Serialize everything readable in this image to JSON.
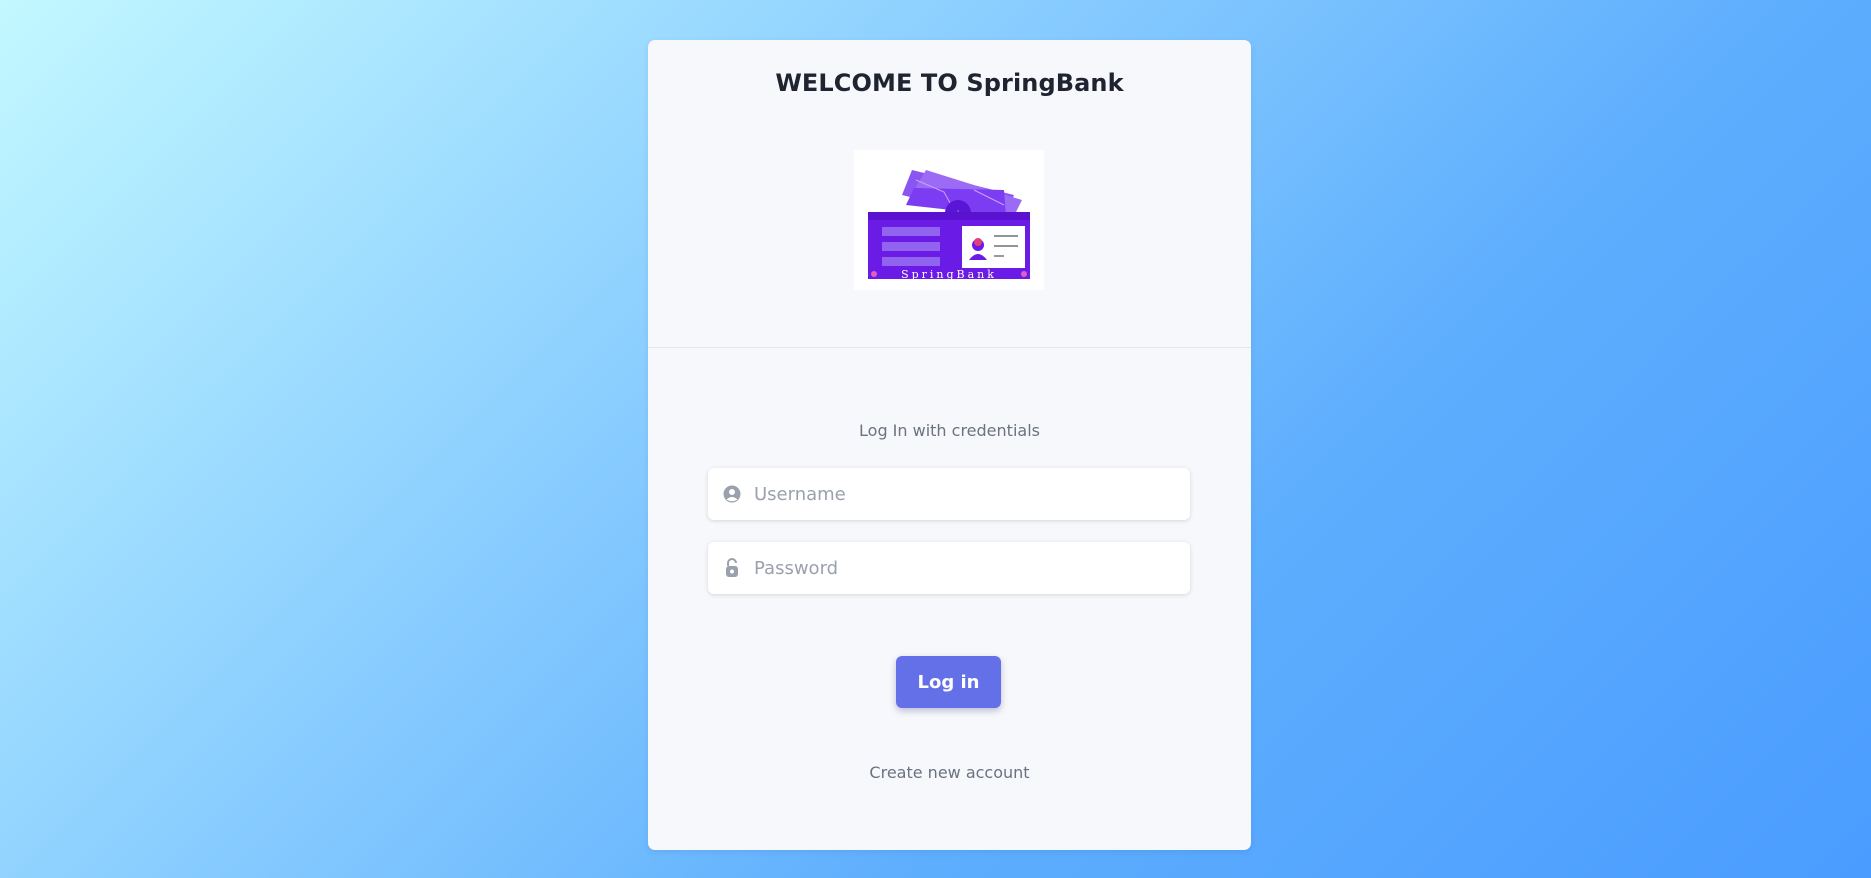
{
  "header": {
    "title": "WELCOME TO SpringBank",
    "logo_text": "SpringBank"
  },
  "form": {
    "subtitle": "Log In with credentials",
    "username": {
      "placeholder": "Username",
      "value": ""
    },
    "password": {
      "placeholder": "Password",
      "value": ""
    },
    "submit_label": "Log in",
    "create_account_label": "Create new account"
  },
  "colors": {
    "accent": "#6470e8",
    "logo_purple": "#6a1be6",
    "card_bg": "#f6f8fb"
  },
  "icons": {
    "username": "user-circle-icon",
    "password": "unlock-icon"
  }
}
